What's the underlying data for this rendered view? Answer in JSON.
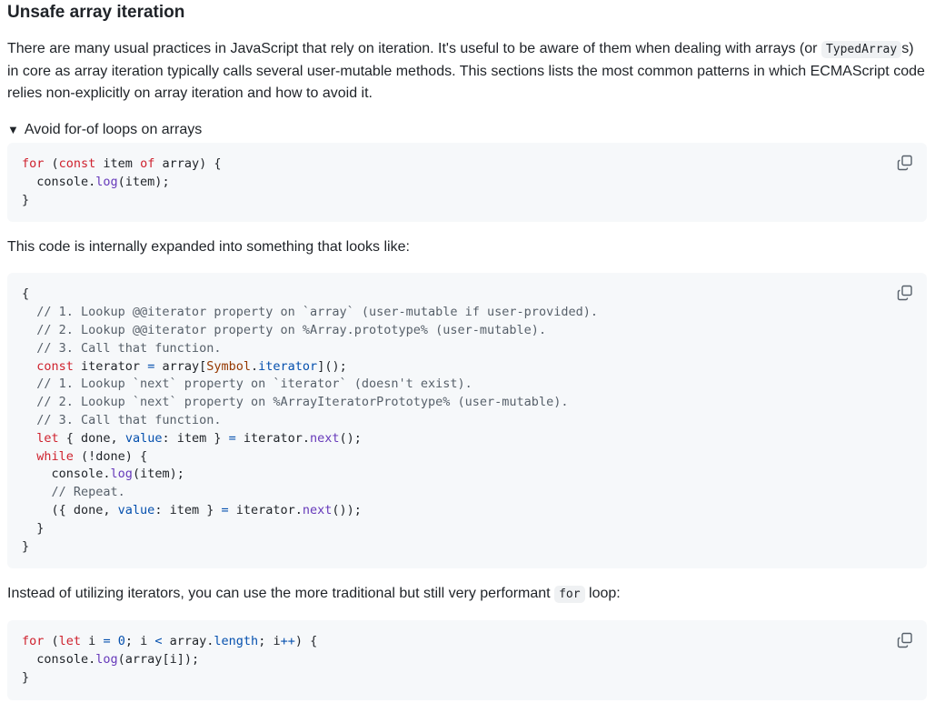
{
  "heading": "Unsafe array iteration",
  "intro": {
    "before": "There are many usual practices in JavaScript that rely on iteration. It's useful to be aware of them when dealing with arrays (or ",
    "code": "TypedArray",
    "after": "s) in core as array iteration typically calls several user-mutable methods. This sections lists the most common patterns in which ECMAScript code relies non-explicitly on array iteration and how to avoid it."
  },
  "details": {
    "marker": "▼",
    "summary": "Avoid for-of loops on arrays"
  },
  "code_block_1": {
    "lines": [
      "for (const item of array) {",
      "  console.log(item);",
      "}"
    ]
  },
  "paragraph_2": "This code is internally expanded into something that looks like:",
  "code_block_2": {
    "lines": [
      "{",
      "  // 1. Lookup @@iterator property on `array` (user-mutable if user-provided).",
      "  // 2. Lookup @@iterator property on %Array.prototype% (user-mutable).",
      "  // 3. Call that function.",
      "  const iterator = array[Symbol.iterator]();",
      "  // 1. Lookup `next` property on `iterator` (doesn't exist).",
      "  // 2. Lookup `next` property on %ArrayIteratorPrototype% (user-mutable).",
      "  // 3. Call that function.",
      "  let { done, value: item } = iterator.next();",
      "  while (!done) {",
      "    console.log(item);",
      "    // Repeat.",
      "    ({ done, value: item } = iterator.next());",
      "  }",
      "}"
    ]
  },
  "paragraph_3": {
    "before": "Instead of utilizing iterators, you can use the more traditional but still very performant ",
    "code": "for",
    "after": " loop:"
  },
  "code_block_3": {
    "lines": [
      "for (let i = 0; i < array.length; i++) {",
      "  console.log(array[i]);",
      "}"
    ]
  },
  "icons": {
    "copy": "copy-icon",
    "disclosure": "triangle-down-icon"
  },
  "colors": {
    "keyword": "#cf222e",
    "function": "#6639ba",
    "property": "#0550ae",
    "comment": "#57606a",
    "builtin": "#953800",
    "code_bg": "#f6f8fa"
  }
}
